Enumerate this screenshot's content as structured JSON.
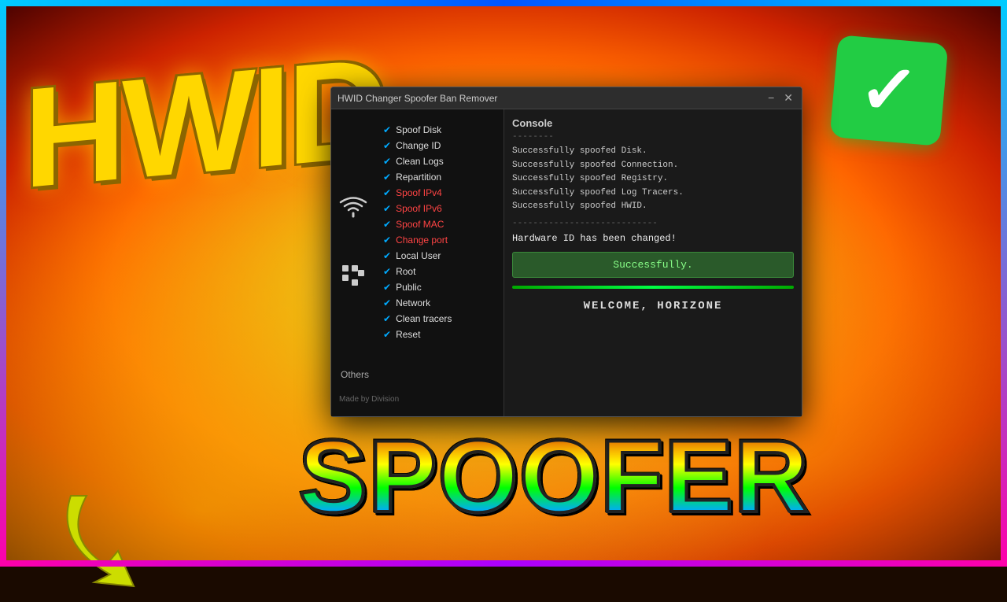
{
  "background": {
    "colors": {
      "primary": "#ffaa00",
      "secondary": "#ff4400",
      "dark": "#1a0a00"
    }
  },
  "hwid_text": "HWID",
  "spoofer_text": "SPOOFER",
  "arrow_color": "#ccdd00",
  "checkmark": {
    "color": "#22cc44",
    "symbol": "✓"
  },
  "window": {
    "title": "HWID Changer Spoofer Ban Remover",
    "controls": {
      "minimize": "−",
      "close": "✕"
    }
  },
  "left_panel": {
    "items": [
      {
        "checked": true,
        "label": "Spoof Disk",
        "color": "normal"
      },
      {
        "checked": true,
        "label": "Change ID",
        "color": "normal"
      },
      {
        "checked": true,
        "label": "Clean Logs",
        "color": "normal"
      },
      {
        "checked": true,
        "label": "Repartition",
        "color": "normal"
      },
      {
        "checked": true,
        "label": "Spoof IPv4",
        "color": "red"
      },
      {
        "checked": true,
        "label": "Spoof IPv6",
        "color": "red"
      },
      {
        "checked": true,
        "label": "Spoof MAC",
        "color": "red"
      },
      {
        "checked": true,
        "label": "Change port",
        "color": "red"
      },
      {
        "checked": true,
        "label": "Local User",
        "color": "normal"
      },
      {
        "checked": true,
        "label": "Root",
        "color": "normal"
      },
      {
        "checked": true,
        "label": "Public",
        "color": "normal"
      },
      {
        "checked": true,
        "label": "Network",
        "color": "normal"
      },
      {
        "checked": true,
        "label": "Clean tracers",
        "color": "normal"
      },
      {
        "checked": true,
        "label": "Reset",
        "color": "normal"
      }
    ],
    "others_label": "Others",
    "made_by": "Made by Division"
  },
  "console": {
    "label": "Console",
    "divider1": "--------",
    "lines": [
      "Successfully spoofed Disk.",
      "Successfully spoofed Connection.",
      "Successfully spoofed Registry.",
      "Successfully spoofed Log Tracers.",
      "Successfully spoofed HWID."
    ],
    "divider2": "----------------------------",
    "hwid_changed": "Hardware ID has been changed!",
    "success_label": "Successfully.",
    "welcome": "WELCOME, HORIZONE"
  }
}
